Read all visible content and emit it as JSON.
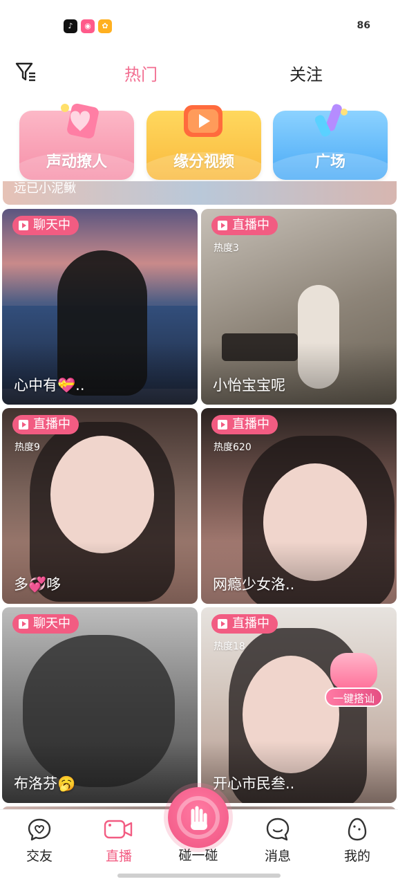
{
  "status_bar": {
    "battery": "86"
  },
  "top_nav": {
    "tab_hot": "热门",
    "tab_follow": "关注"
  },
  "feature_cards": [
    {
      "label": "声动撩人",
      "color": "#f68fa8"
    },
    {
      "label": "缘分视频",
      "color": "#f9b93d"
    },
    {
      "label": "广场",
      "color": "#4aaaf6"
    }
  ],
  "banner": {
    "text": "远已小泥鳅"
  },
  "streams": [
    {
      "status": "聊天中",
      "heat": "",
      "name": "心中有💝.."
    },
    {
      "status": "直播中",
      "heat": "热度3",
      "name": "小怡宝宝呢"
    },
    {
      "status": "直播中",
      "heat": "热度9",
      "name": "多💞哆"
    },
    {
      "status": "直播中",
      "heat": "热度620",
      "name": "网瘾少女洛.."
    },
    {
      "status": "聊天中",
      "heat": "",
      "name": "布洛芬🥱"
    },
    {
      "status": "直播中",
      "heat": "热度18",
      "name": "开心市民叁.."
    }
  ],
  "quick_pickup": {
    "label": "一键搭讪"
  },
  "tabbar": {
    "jiaoyou": "交友",
    "zhibo": "直播",
    "pengyipeng": "碰一碰",
    "xiaoxi": "消息",
    "wode": "我的"
  },
  "colors": {
    "accent": "#f25c82",
    "text": "#222222"
  }
}
